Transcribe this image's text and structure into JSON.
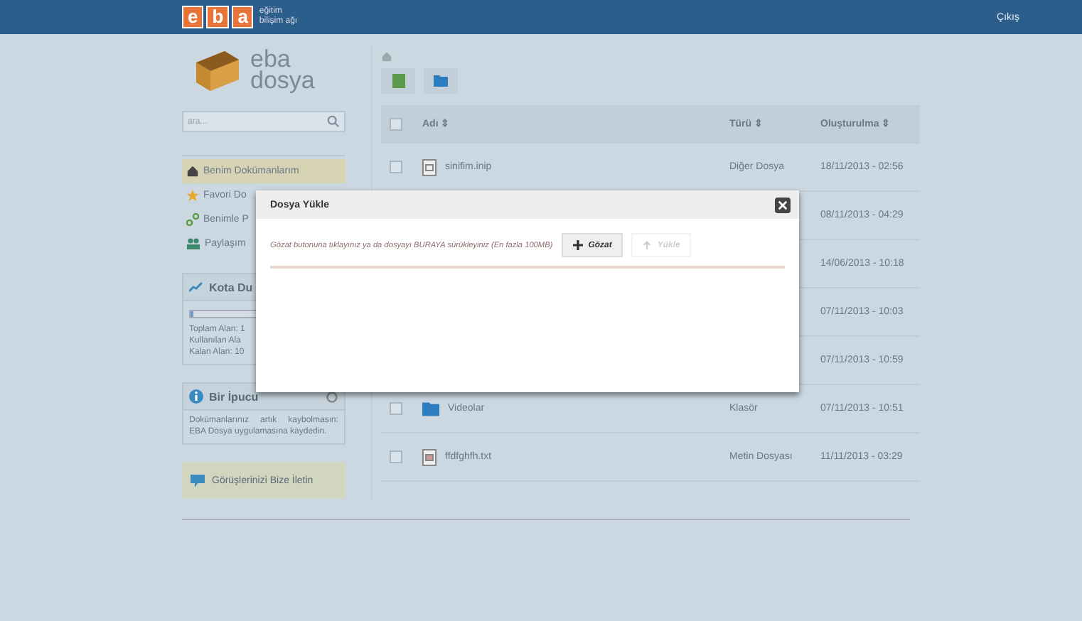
{
  "topbar": {
    "logo_letters": [
      "e",
      "b",
      "a"
    ],
    "tagline": [
      "eğitim",
      "bilişim ağı"
    ],
    "logout": "Çıkış"
  },
  "sidebar": {
    "brand": [
      "eba",
      "dosya"
    ],
    "search": {
      "placeholder": "ara..."
    },
    "nav": [
      {
        "kind": "home",
        "label": "Benim Dokümanlarım",
        "selected": true
      },
      {
        "kind": "star",
        "label": "Favori Do",
        "selected": false
      },
      {
        "kind": "share",
        "label": "Benimle P",
        "selected": false
      },
      {
        "kind": "users",
        "label": "Paylaşım",
        "selected": false
      }
    ],
    "quota": {
      "title": "Kota Du",
      "level": 0.02,
      "lines": [
        "Toplam Alan: 1",
        "Kullanılan Ala",
        "Kalan Alan: 10"
      ]
    },
    "tip": {
      "title": "Bir İpucu",
      "text": "Dokümanlarınız artık kaybolmasın: EBA Dosya uygulamasına kaydedin."
    },
    "feedback": "Görüşlerinizi Bize İletin"
  },
  "table": {
    "select_all_checked": false,
    "columns": [
      "Adı ⇕",
      "Türü ⇕",
      "Oluşturulma ⇕"
    ],
    "rows": [
      {
        "kind": "file",
        "name": "sinifim.inip",
        "type": "Diğer Dosya",
        "date": "18/11/2013 - 02:56",
        "checked": false
      },
      {
        "kind": "hidden",
        "date": "08/11/2013 - 04:29"
      },
      {
        "kind": "hidden",
        "date": "14/06/2013 - 10:18"
      },
      {
        "kind": "hidden",
        "date": "07/11/2013 - 10:03"
      },
      {
        "kind": "hidden",
        "date": "07/11/2013 - 10:59"
      },
      {
        "kind": "folder",
        "name": "Videolar",
        "type": "Klasör",
        "date": "07/11/2013 - 10:51",
        "checked": false
      },
      {
        "kind": "text",
        "name": "ffdfghfh.txt",
        "type": "Metin Dosyası",
        "date": "11/11/2013 - 03:29",
        "checked": false
      }
    ]
  },
  "modal": {
    "title": "Dosya Yükle",
    "hint": "Gözat butonuna tıklayınız ya da dosyayı BURAYA sürükleyiniz (En fazla 100MB)",
    "buttons": [
      {
        "kind": "browse",
        "label": "Gözat",
        "disabled": false
      },
      {
        "kind": "upload",
        "label": "Yükle",
        "disabled": true
      }
    ]
  }
}
